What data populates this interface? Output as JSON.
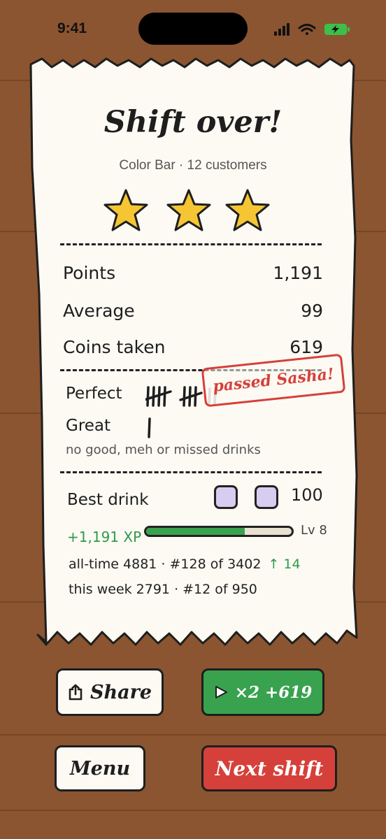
{
  "status_bar": {
    "time": "9:41",
    "icons": [
      "signal-icon",
      "wifi-icon",
      "battery-icon"
    ]
  },
  "receipt": {
    "title": "Shift over!",
    "subtitle": "Color Bar · 12 customers",
    "stars": {
      "earned": 3,
      "total": 3
    },
    "totals": [
      {
        "label": "Points",
        "value": "1,191"
      },
      {
        "label": "Average",
        "value": "99"
      },
      {
        "label": "Coins taken",
        "value": "619"
      }
    ],
    "ratings": {
      "perfect_label": "Perfect",
      "great_label": "Great",
      "stamp": "passed Sasha!",
      "note": "no good, meh or missed drinks"
    },
    "best_drink": {
      "label": "Best drink",
      "value": "100"
    },
    "xp": {
      "gain": "+1,191 XP",
      "progress": 0.68,
      "level": "Lv 8"
    },
    "stats": {
      "all_time": "all-time 4881 · #128 of 3402",
      "all_time_change": "↑ 14",
      "week": "this week 2791 · #12 of 950"
    }
  },
  "buttons": {
    "share": "Share",
    "double": "×2 +619",
    "menu": "Menu",
    "next": "Next shift"
  },
  "colors": {
    "background": "#8a5530",
    "paper": "#fcfaf3",
    "accent_green": "#39a24f",
    "accent_red": "#d6403a",
    "star": "#f5c534"
  }
}
